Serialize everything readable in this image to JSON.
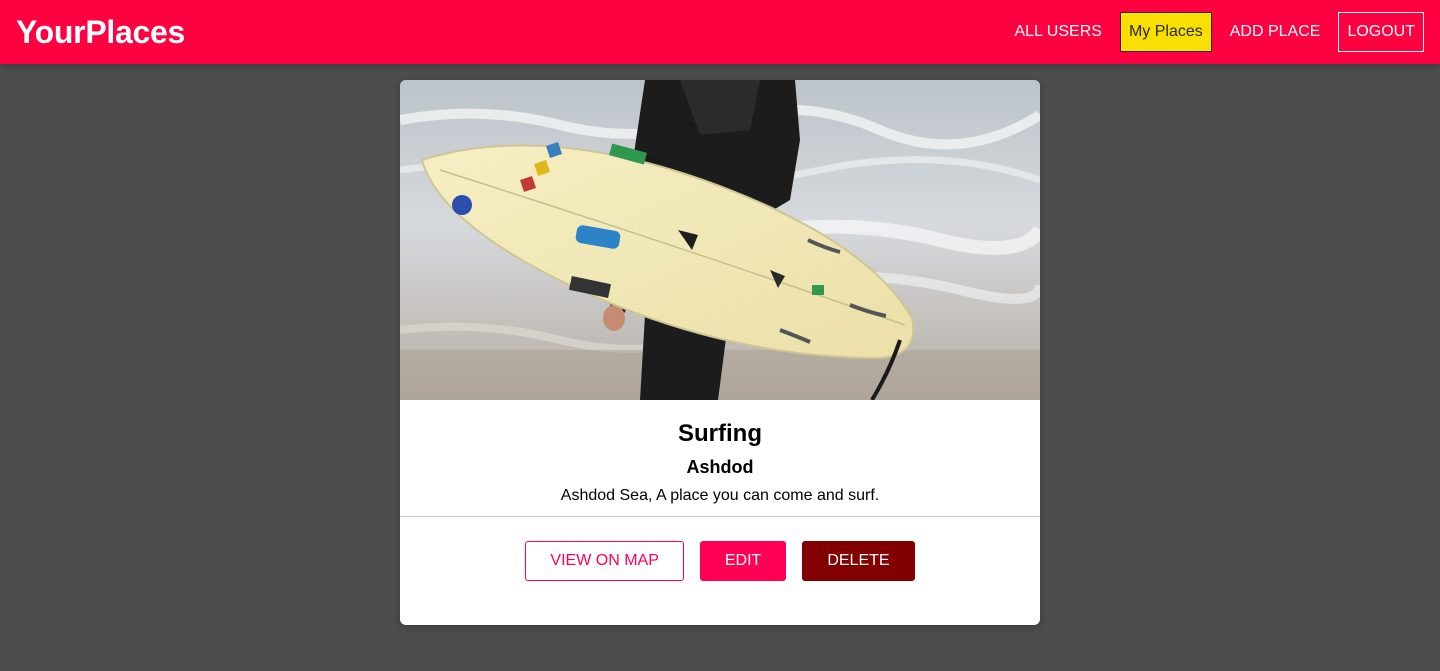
{
  "header": {
    "logo": "YourPlaces",
    "nav": {
      "all_users": "ALL USERS",
      "my_places": "My Places",
      "add_place": "ADD PLACE",
      "logout": "LOGOUT"
    }
  },
  "place": {
    "title": "Surfing",
    "subtitle": "Ashdod",
    "description": "Ashdod Sea, A place you can come and surf.",
    "image_alt": "Surfing",
    "actions": {
      "view_on_map": "VIEW ON MAP",
      "edit": "EDIT",
      "delete": "DELETE"
    }
  },
  "colors": {
    "header_bg": "#ff0041",
    "active_nav_bg": "#f8df00",
    "primary": "#ff0055",
    "danger": "#830000",
    "page_bg": "#4d4d4d"
  }
}
